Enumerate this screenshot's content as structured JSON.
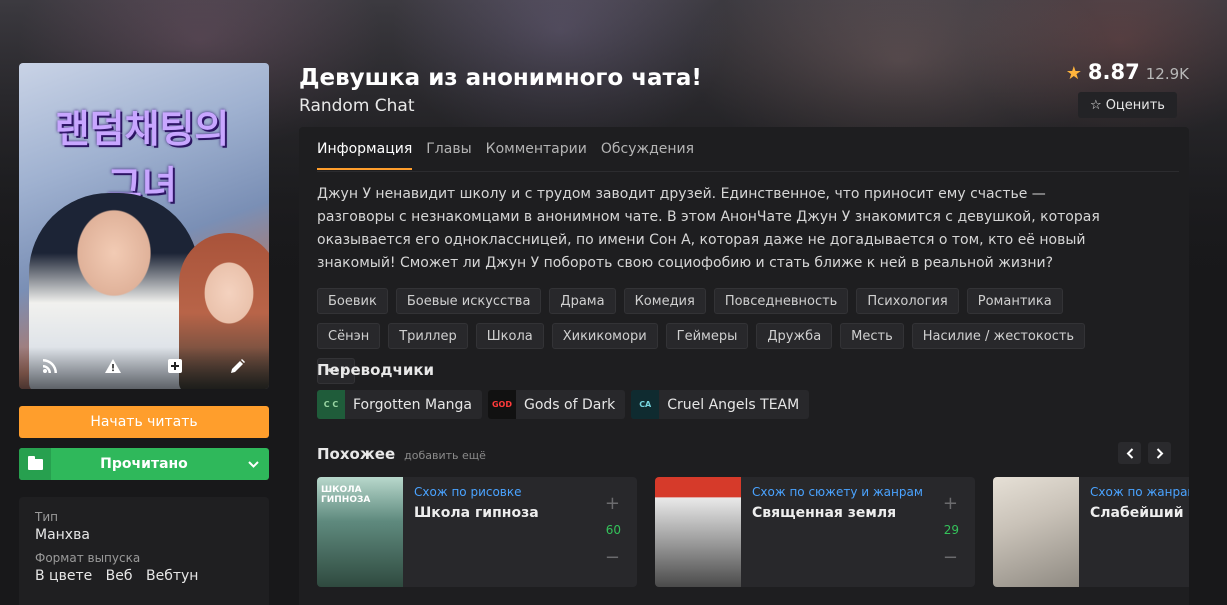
{
  "manga": {
    "title": "Девушка из анонимного чата!",
    "alt_title": "Random Chat",
    "cover_text": "랜덤채팅의\n그녀",
    "rating": {
      "score": "8.87",
      "votes": "12.9K",
      "rate_label": "Оценить"
    }
  },
  "actions": {
    "read_label": "Начать читать",
    "status_label": "Прочитано"
  },
  "info": {
    "type_label": "Тип",
    "type_value": "Манхва",
    "format_label": "Формат выпуска",
    "format_values": [
      "В цвете",
      "Веб",
      "Вебтун"
    ]
  },
  "tabs": [
    {
      "label": "Информация",
      "active": true
    },
    {
      "label": "Главы",
      "active": false
    },
    {
      "label": "Комментарии",
      "active": false
    },
    {
      "label": "Обсуждения",
      "active": false
    }
  ],
  "description": "Джун У ненавидит школу и с трудом заводит друзей. Единственное, что приносит ему счастье — разговоры с незнакомцами в анонимном чате. В этом АнонЧате Джун У знакомится с девушкой, которая оказывается его одноклассницей, по имени Сон А, которая даже не догадывается о том, кто её новый знакомый! Сможет ли Джун У побороть свою социофобию и стать ближе к ней в реальной жизни?",
  "tags": [
    "Боевик",
    "Боевые искусства",
    "Драма",
    "Комедия",
    "Повседневность",
    "Психология",
    "Романтика",
    "Сёнэн",
    "Триллер",
    "Школа",
    "Хикикомори",
    "Геймеры",
    "Дружба",
    "Месть",
    "Насилие / жестокость"
  ],
  "tags_more": "•••",
  "translators_title": "Переводчики",
  "translators": [
    {
      "name": "Forgotten Manga",
      "avatar": "C C"
    },
    {
      "name": "Gods of Dark",
      "avatar": "GOD"
    },
    {
      "name": "Cruel Angels TEAM",
      "avatar": "CA"
    }
  ],
  "similar": {
    "title": "Похожее",
    "add_label": "добавить ещё",
    "items": [
      {
        "reason": "Схож по рисовке",
        "name": "Школа гипноза",
        "count": "60"
      },
      {
        "reason": "Схож по сюжету и жанрам",
        "name": "Священная земля",
        "count": "29"
      },
      {
        "reason": "Схож по жанрам",
        "name": "Слабейший Ге",
        "count": ""
      }
    ]
  },
  "colors": {
    "accent": "#ff9e2c",
    "success": "#2fb85b",
    "link": "#4aa3ff"
  }
}
